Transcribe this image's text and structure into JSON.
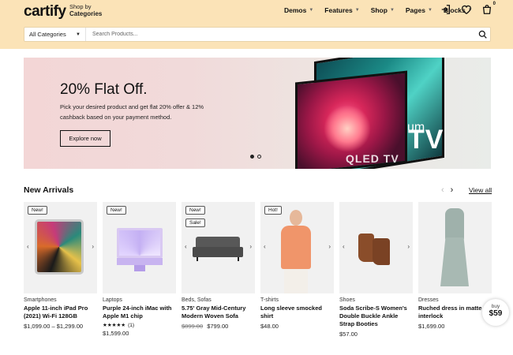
{
  "brand": {
    "logo": "cartify"
  },
  "header": {
    "shop_by_small": "Shop by",
    "shop_by_strong": "Categories",
    "nav": [
      {
        "label": "Demos"
      },
      {
        "label": "Features"
      },
      {
        "label": "Shop"
      },
      {
        "label": "Pages"
      },
      {
        "label": "Blocks"
      }
    ],
    "cart_count": "0"
  },
  "search": {
    "category": "All Categories",
    "placeholder": "Search Products..."
  },
  "hero": {
    "title": "20% Flat Off.",
    "subtitle": "Pick your desired product and get flat 20% offer & 12% cashback based on your payment method.",
    "button": "Explore now",
    "tv_qled": "QLED TV",
    "tv_um": "um",
    "tv_big": "TV"
  },
  "arrivals": {
    "title": "New Arrivals",
    "view_all": "View all",
    "products": [
      {
        "badges": [
          "New!"
        ],
        "category": "Smartphones",
        "name": "Apple 11-inch iPad Pro (2021) Wi-Fi 128GB",
        "price": "$1,099.00 – $1,299.00"
      },
      {
        "badges": [
          "New!"
        ],
        "category": "Laptops",
        "name": "Purple 24-inch iMac with Apple M1 chip",
        "stars": "★★★★★",
        "reviews": "(1)",
        "price": "$1,599.00"
      },
      {
        "badges": [
          "New!",
          "Sale!"
        ],
        "category": "Beds, Sofas",
        "name": "5.75' Gray Mid-Century Modern Woven Sofa",
        "old_price": "$899.00",
        "price": "$799.00"
      },
      {
        "badges": [
          "Hot!"
        ],
        "category": "T-shirts",
        "name": "Long sleeve smocked shirt",
        "price": "$48.00"
      },
      {
        "badges": [],
        "category": "Shoes",
        "name": "Soda Scribe-S Women's Double Buckle Ankle Strap Booties",
        "price": "$57.00"
      },
      {
        "badges": [],
        "category": "Dresses",
        "name": "Ruched dress in matte interlock",
        "price": "$1,699.00"
      }
    ]
  },
  "buy_bubble": {
    "label": "buy",
    "price": "$59"
  },
  "colors": {
    "header_bg": "#fbe3b7",
    "hero_pink": "#f3d6d6"
  }
}
